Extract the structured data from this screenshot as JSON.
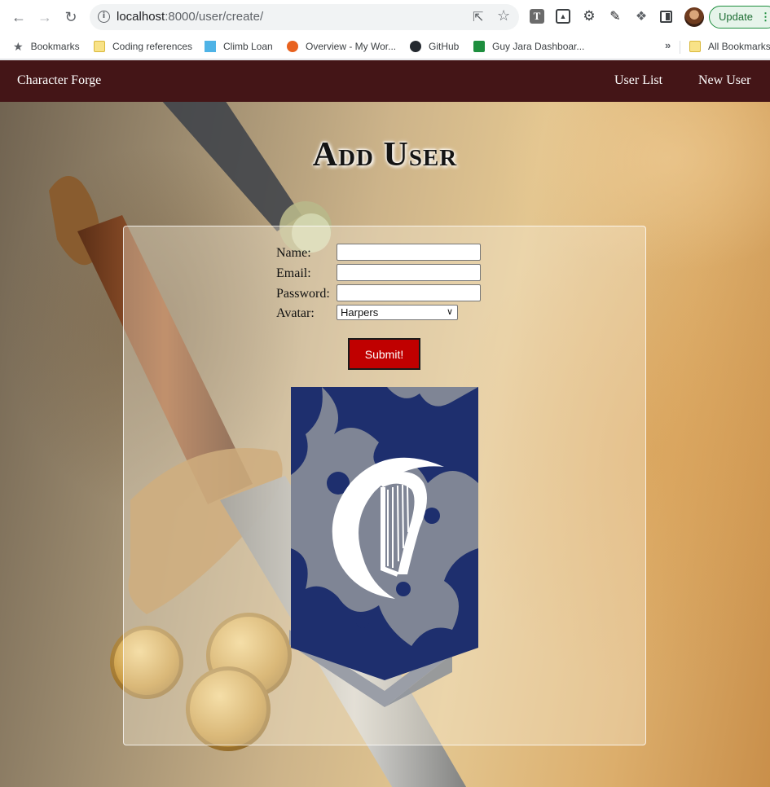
{
  "browser": {
    "url_host": "localhost",
    "url_path": ":8000/user/create/",
    "update_label": "Update",
    "bookmarks": [
      {
        "label": "Bookmarks",
        "icon": "star-icon"
      },
      {
        "label": "Coding references",
        "icon": "folder-icon"
      },
      {
        "label": "Climb Loan",
        "icon": "climb-loan-icon"
      },
      {
        "label": "Overview - My Wor...",
        "icon": "overview-icon"
      },
      {
        "label": "GitHub",
        "icon": "github-icon"
      },
      {
        "label": "Guy Jara Dashboar...",
        "icon": "sheets-icon"
      }
    ],
    "more_bookmarks": "»",
    "all_bookmarks": "All Bookmarks"
  },
  "navbar": {
    "brand": "Character Forge",
    "links": [
      "User List",
      "New User"
    ]
  },
  "page": {
    "title": "Add User"
  },
  "form": {
    "name_label": "Name:",
    "email_label": "Email:",
    "password_label": "Password:",
    "avatar_label": "Avatar:",
    "name_value": "",
    "email_value": "",
    "password_value": "",
    "avatar_selected": "Harpers",
    "submit_label": "Submit!"
  },
  "avatar_image": {
    "emblem": "harpers-harp-crescent",
    "colors": {
      "navy": "#1e2f6e",
      "gray": "#8a8f99",
      "white": "#ffffff"
    }
  },
  "colors": {
    "navbar_bg": "#441517",
    "submit_bg": "#c00000"
  }
}
